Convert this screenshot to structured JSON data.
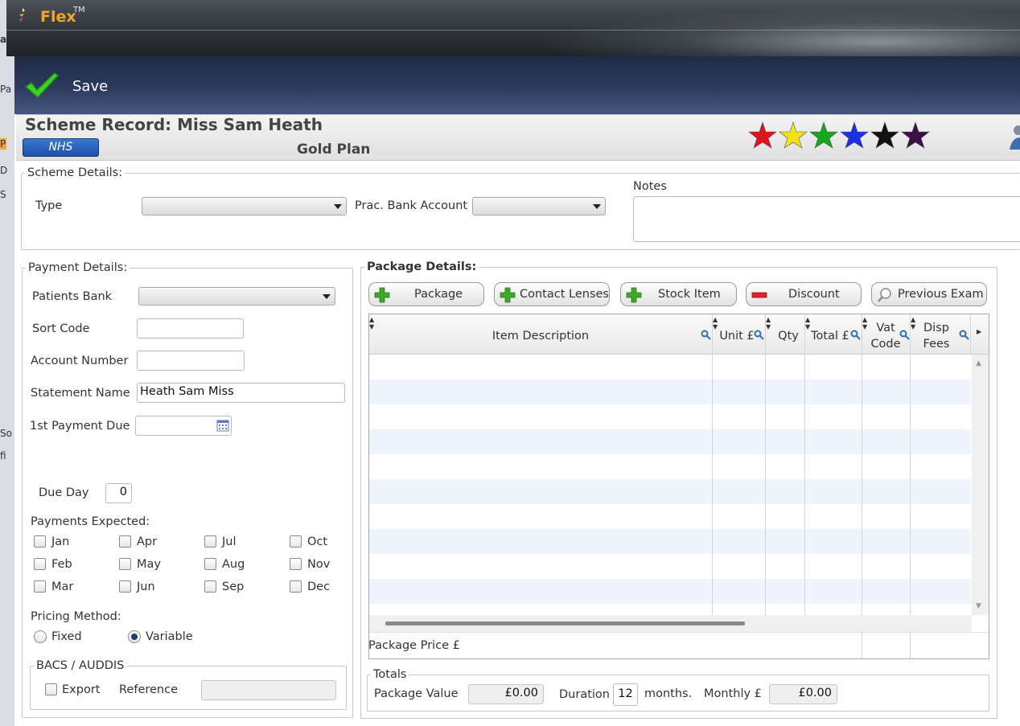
{
  "window": {
    "app_title": "Flex",
    "app_trademark": "TM"
  },
  "background_fragments": [
    "a",
    "Pa",
    "P",
    "D",
    "S",
    "So",
    "fi"
  ],
  "toolbar": {
    "save_label": "Save"
  },
  "header": {
    "record_title": "Scheme Record: Miss Sam Heath",
    "badge": "NHS",
    "plan_name": "Gold Plan",
    "star_colors": [
      "#e0121b",
      "#f5e11a",
      "#17a61e",
      "#1b2fe8",
      "#111111",
      "#3b1045"
    ]
  },
  "scheme_details": {
    "legend": "Scheme Details:",
    "type_label": "Type",
    "type_value": "",
    "bank_account_label": "Prac. Bank Account",
    "bank_account_value": "",
    "notes_label": "Notes",
    "notes_value": ""
  },
  "payment_details": {
    "legend": "Payment Details:",
    "patients_bank_label": "Patients Bank",
    "patients_bank_value": "",
    "sort_code_label": "Sort Code",
    "sort_code_value": "",
    "account_number_label": "Account Number",
    "account_number_value": "",
    "statement_name_label": "Statement Name",
    "statement_name_value": "Heath Sam Miss",
    "first_payment_label": "1st Payment Due",
    "first_payment_value": "",
    "due_day_label": "Due Day",
    "due_day_value": "0",
    "payments_expected_label": "Payments Expected:",
    "months": [
      "Jan",
      "Feb",
      "Mar",
      "Apr",
      "May",
      "Jun",
      "Jul",
      "Aug",
      "Sep",
      "Oct",
      "Nov",
      "Dec"
    ],
    "pricing_method_label": "Pricing Method:",
    "pricing_fixed": "Fixed",
    "pricing_variable": "Variable",
    "pricing_selected": "Variable",
    "bacs_legend": "BACS / AUDDIS",
    "export_label": "Export",
    "reference_label": "Reference",
    "reference_value": ""
  },
  "package_details": {
    "title": "Package Details:",
    "buttons": {
      "package": "Package",
      "contact_lenses": "Contact Lenses",
      "stock_item": "Stock Item",
      "discount": "Discount",
      "previous_exam": "Previous Exam"
    },
    "columns": {
      "item_description": "Item Description",
      "unit": "Unit £",
      "qty": "Qty",
      "total": "Total £",
      "vat_line1": "Vat",
      "vat_line2": "Code",
      "disp_line1": "Disp",
      "disp_line2": "Fees"
    },
    "package_price_label": "Package Price £",
    "totals": {
      "legend": "Totals",
      "package_value_label": "Package Value",
      "package_value": "£0.00",
      "duration_label": "Duration",
      "duration_value": "12",
      "months_label": "months.",
      "monthly_label": "Monthly £",
      "monthly_value": "£0.00"
    }
  }
}
